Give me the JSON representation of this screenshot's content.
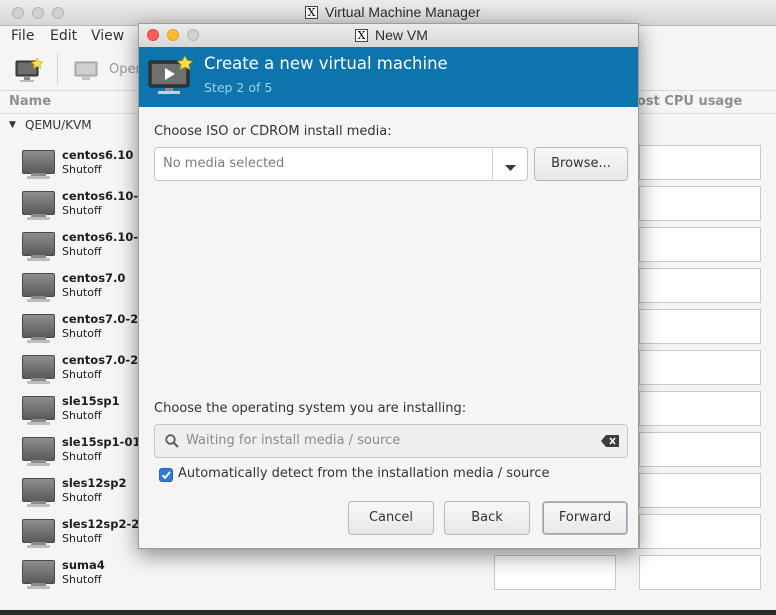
{
  "main_window": {
    "title": "Virtual Machine Manager",
    "menu": [
      "File",
      "Edit",
      "View"
    ],
    "toolbar": {
      "open_label": "Open"
    },
    "columns": {
      "name": "Name",
      "cpu": "Host CPU usage"
    },
    "group": {
      "label": "QEMU/KVM"
    },
    "vms": [
      {
        "name": "centos6.10",
        "status": "Shutoff"
      },
      {
        "name": "centos6.10-",
        "status": "Shutoff"
      },
      {
        "name": "centos6.10-",
        "status": "Shutoff"
      },
      {
        "name": "centos7.0",
        "status": "Shutoff"
      },
      {
        "name": "centos7.0-2",
        "status": "Shutoff"
      },
      {
        "name": "centos7.0-2",
        "status": "Shutoff"
      },
      {
        "name": "sle15sp1",
        "status": "Shutoff"
      },
      {
        "name": "sle15sp1-01",
        "status": "Shutoff"
      },
      {
        "name": "sles12sp2",
        "status": "Shutoff"
      },
      {
        "name": "sles12sp2-2",
        "status": "Shutoff"
      },
      {
        "name": "suma4",
        "status": "Shutoff"
      }
    ]
  },
  "dialog": {
    "window_title": "New VM",
    "banner": {
      "title": "Create a new virtual machine",
      "subtitle": "Step 2 of 5"
    },
    "media": {
      "label": "Choose ISO or CDROM install media:",
      "value": "No media selected",
      "browse_label": "Browse..."
    },
    "os": {
      "label": "Choose the operating system you are installing:",
      "search_placeholder": "Waiting for install media / source"
    },
    "autodetect": {
      "label": "Automatically detect from the installation media / source",
      "checked": true
    },
    "buttons": {
      "cancel": "Cancel",
      "back": "Back",
      "forward": "Forward"
    }
  },
  "colors": {
    "banner": "#0d74ae",
    "banner_subtitle": "#9ed1ef",
    "checkbox": "#2f7bd6"
  },
  "icons": [
    "new-vm-icon",
    "monitor-icon",
    "search-icon",
    "clear-icon",
    "dropdown-arrow-icon",
    "expander-icon"
  ]
}
